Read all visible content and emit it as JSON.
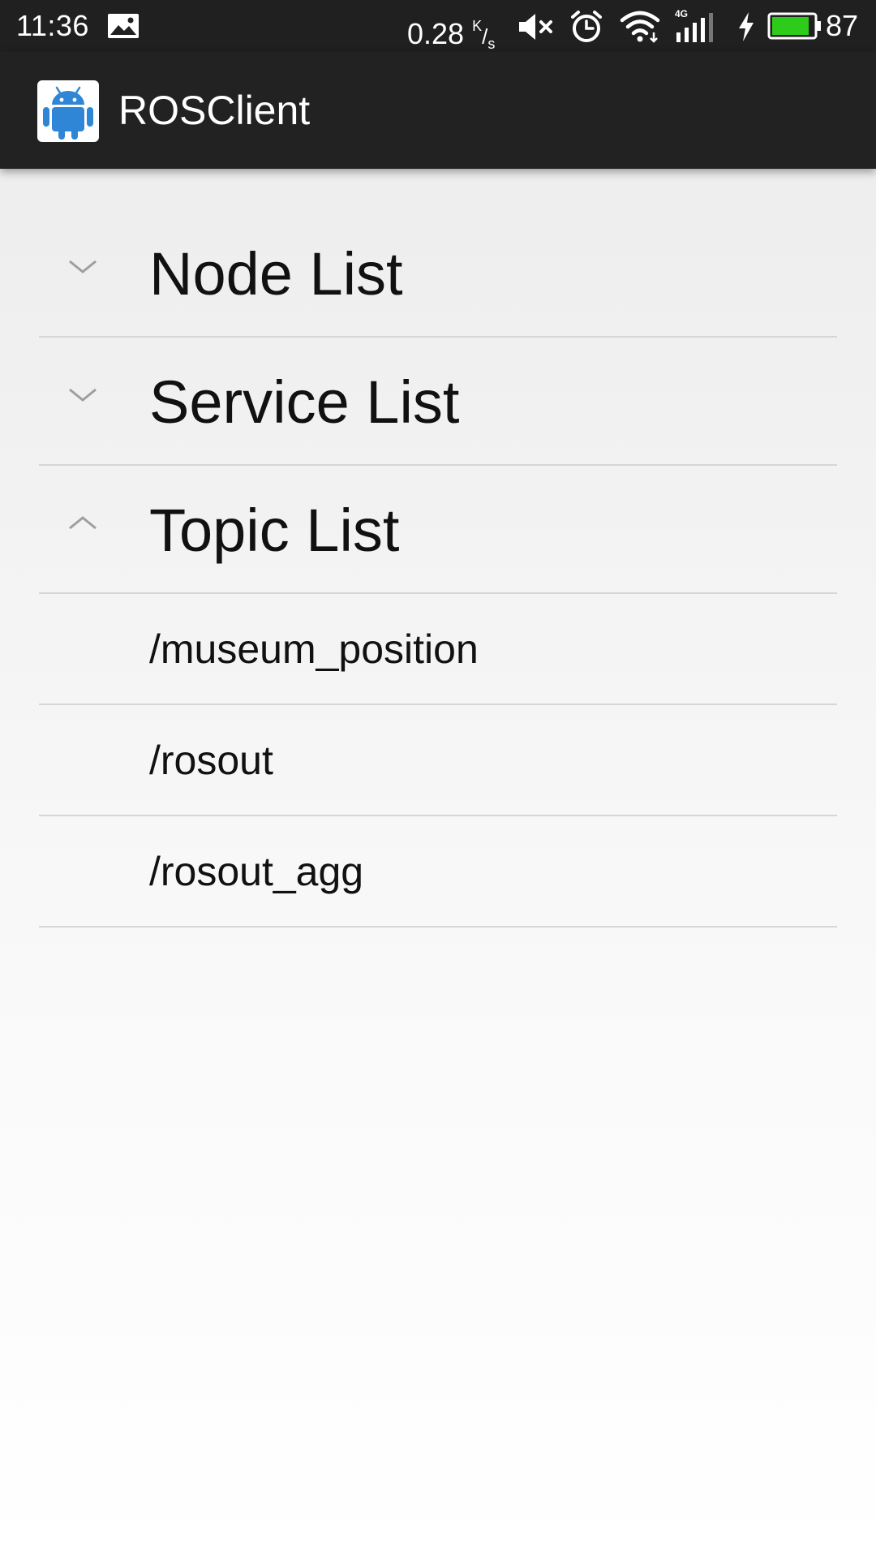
{
  "status_bar": {
    "time": "11:36",
    "net_speed_value": "0.28",
    "net_speed_unit_k": "K",
    "net_speed_unit_slash": "/",
    "net_speed_unit_s": "s",
    "network_type": "4G",
    "battery_level": "87",
    "battery_color": "#2ecc1a",
    "icons": [
      "photo-icon",
      "mute-icon",
      "alarm-icon",
      "wifi-icon",
      "signal-icon",
      "charging-icon",
      "battery-icon"
    ]
  },
  "app_bar": {
    "icon": "android-icon",
    "icon_color": "#2f86d6",
    "title": "ROSClient"
  },
  "groups": [
    {
      "label": "Node List",
      "expanded": false,
      "icon": "chevron-down-icon"
    },
    {
      "label": "Service List",
      "expanded": false,
      "icon": "chevron-down-icon"
    },
    {
      "label": "Topic List",
      "expanded": true,
      "icon": "chevron-up-icon",
      "children": [
        "/museum_position",
        "/rosout",
        "/rosout_agg"
      ]
    }
  ]
}
